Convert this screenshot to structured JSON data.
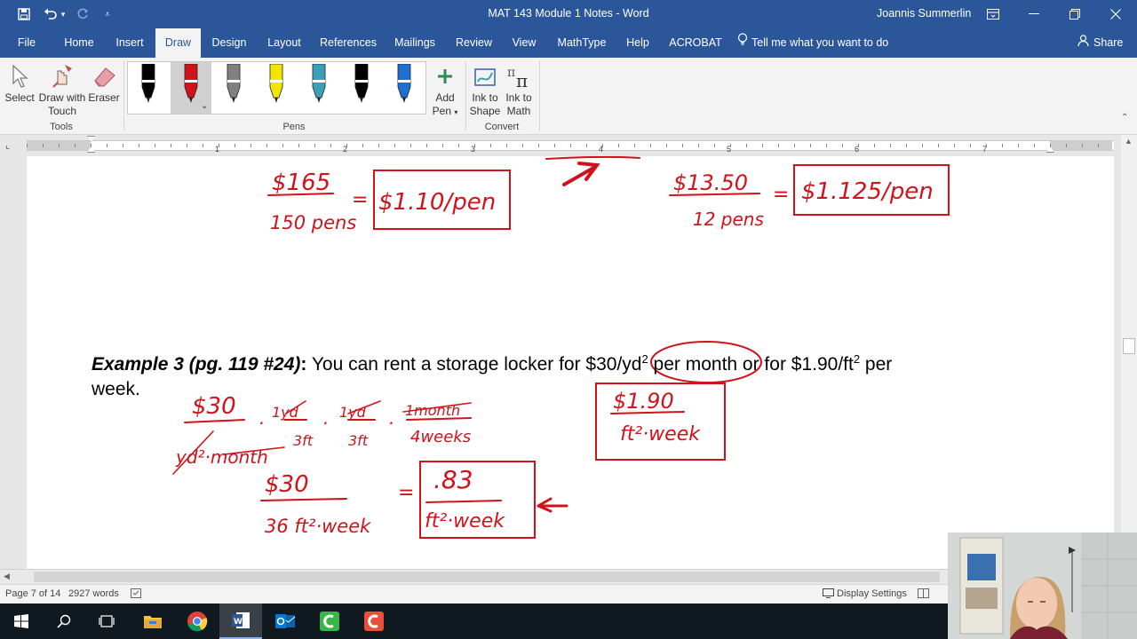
{
  "window": {
    "title": "MAT 143 Module 1 Notes  -  Word",
    "user": "Joannis Summerlin"
  },
  "quick_access": [
    "save-icon",
    "undo-icon",
    "redo-icon",
    "customize-icon"
  ],
  "tabs": [
    {
      "label": "File"
    },
    {
      "label": "Home"
    },
    {
      "label": "Insert"
    },
    {
      "label": "Draw"
    },
    {
      "label": "Design"
    },
    {
      "label": "Layout"
    },
    {
      "label": "References"
    },
    {
      "label": "Mailings"
    },
    {
      "label": "Review"
    },
    {
      "label": "View"
    },
    {
      "label": "MathType"
    },
    {
      "label": "Help"
    },
    {
      "label": "ACROBAT"
    }
  ],
  "active_tab": "Draw",
  "tell_me": "Tell me what you want to do",
  "share": "Share",
  "ribbon": {
    "tools": {
      "select": "Select",
      "draw_touch_1": "Draw with",
      "draw_touch_2": "Touch",
      "eraser": "Eraser",
      "group": "Tools"
    },
    "pens": {
      "group": "Pens",
      "colors": [
        "#000000",
        "#d0121b",
        "#808080",
        "#f2e600",
        "#3aa0b8",
        "#000000",
        "#1f6fd1"
      ]
    },
    "add_pen_1": "Add",
    "add_pen_2": "Pen",
    "convert": {
      "ink_shape_1": "Ink to",
      "ink_shape_2": "Shape",
      "ink_math_1": "Ink to",
      "ink_math_2": "Math",
      "group": "Convert"
    }
  },
  "ruler_numbers": [
    "1",
    "2",
    "3",
    "4",
    "5",
    "6",
    "7"
  ],
  "document": {
    "example_title": "Example 3 (pg. 119 #24)",
    "colon": ":",
    "text_1": "  You can rent a storage locker for $30/yd",
    "sup_1": "2",
    "text_2": " per month or for $1.90/ft",
    "sup_2": "2",
    "text_3": " per",
    "text_line2": "week.",
    "ink_color": "#d0121b",
    "ink": {
      "a_num": "$165",
      "a_den": "150 pens",
      "a_eq": "=",
      "a_box": "$1.10/pen",
      "b_num": "$13.50",
      "b_den": "12 pens",
      "b_eq": "=",
      "b_box": "$1.125/pen",
      "c_num": "$30",
      "c_dot1": ".",
      "c_f1_num": "1yd",
      "c_f1_den": "3ft",
      "c_dot2": ".",
      "c_f2_num": "1yd",
      "c_f2_den": "3ft",
      "c_dot3": ".",
      "c_f3_num": "1month",
      "c_f3_den": "4weeks",
      "c_den": "yd²·month",
      "d_num": "$30",
      "d_den": "36 ft²·week",
      "d_eq": "=",
      "d_box_num": ".83",
      "d_box_den": "ft²·week",
      "e_box_num": "$1.90",
      "e_box_den": "ft²·week"
    }
  },
  "status": {
    "page": "Page 7 of 14",
    "words": "2927 words",
    "display_settings": "Display Settings"
  },
  "taskbar": [
    "windows-start-icon",
    "search-icon",
    "task-view-icon",
    "file-explorer-icon",
    "chrome-icon",
    "word-icon",
    "outlook-icon",
    "camtasia-icon",
    "camtasia-recorder-icon"
  ]
}
